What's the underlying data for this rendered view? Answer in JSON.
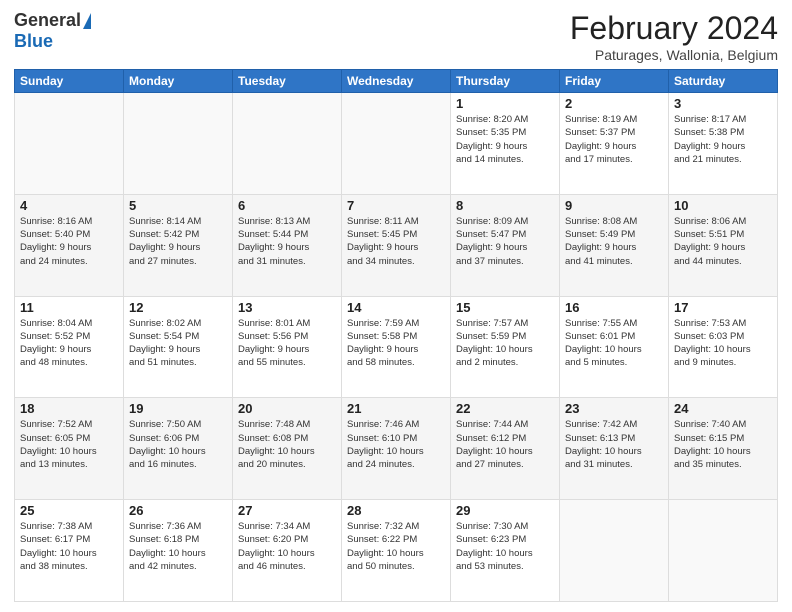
{
  "header": {
    "logo_general": "General",
    "logo_blue": "Blue",
    "title": "February 2024",
    "location": "Paturages, Wallonia, Belgium"
  },
  "days_of_week": [
    "Sunday",
    "Monday",
    "Tuesday",
    "Wednesday",
    "Thursday",
    "Friday",
    "Saturday"
  ],
  "weeks": [
    [
      {
        "day": "",
        "info": ""
      },
      {
        "day": "",
        "info": ""
      },
      {
        "day": "",
        "info": ""
      },
      {
        "day": "",
        "info": ""
      },
      {
        "day": "1",
        "info": "Sunrise: 8:20 AM\nSunset: 5:35 PM\nDaylight: 9 hours\nand 14 minutes."
      },
      {
        "day": "2",
        "info": "Sunrise: 8:19 AM\nSunset: 5:37 PM\nDaylight: 9 hours\nand 17 minutes."
      },
      {
        "day": "3",
        "info": "Sunrise: 8:17 AM\nSunset: 5:38 PM\nDaylight: 9 hours\nand 21 minutes."
      }
    ],
    [
      {
        "day": "4",
        "info": "Sunrise: 8:16 AM\nSunset: 5:40 PM\nDaylight: 9 hours\nand 24 minutes."
      },
      {
        "day": "5",
        "info": "Sunrise: 8:14 AM\nSunset: 5:42 PM\nDaylight: 9 hours\nand 27 minutes."
      },
      {
        "day": "6",
        "info": "Sunrise: 8:13 AM\nSunset: 5:44 PM\nDaylight: 9 hours\nand 31 minutes."
      },
      {
        "day": "7",
        "info": "Sunrise: 8:11 AM\nSunset: 5:45 PM\nDaylight: 9 hours\nand 34 minutes."
      },
      {
        "day": "8",
        "info": "Sunrise: 8:09 AM\nSunset: 5:47 PM\nDaylight: 9 hours\nand 37 minutes."
      },
      {
        "day": "9",
        "info": "Sunrise: 8:08 AM\nSunset: 5:49 PM\nDaylight: 9 hours\nand 41 minutes."
      },
      {
        "day": "10",
        "info": "Sunrise: 8:06 AM\nSunset: 5:51 PM\nDaylight: 9 hours\nand 44 minutes."
      }
    ],
    [
      {
        "day": "11",
        "info": "Sunrise: 8:04 AM\nSunset: 5:52 PM\nDaylight: 9 hours\nand 48 minutes."
      },
      {
        "day": "12",
        "info": "Sunrise: 8:02 AM\nSunset: 5:54 PM\nDaylight: 9 hours\nand 51 minutes."
      },
      {
        "day": "13",
        "info": "Sunrise: 8:01 AM\nSunset: 5:56 PM\nDaylight: 9 hours\nand 55 minutes."
      },
      {
        "day": "14",
        "info": "Sunrise: 7:59 AM\nSunset: 5:58 PM\nDaylight: 9 hours\nand 58 minutes."
      },
      {
        "day": "15",
        "info": "Sunrise: 7:57 AM\nSunset: 5:59 PM\nDaylight: 10 hours\nand 2 minutes."
      },
      {
        "day": "16",
        "info": "Sunrise: 7:55 AM\nSunset: 6:01 PM\nDaylight: 10 hours\nand 5 minutes."
      },
      {
        "day": "17",
        "info": "Sunrise: 7:53 AM\nSunset: 6:03 PM\nDaylight: 10 hours\nand 9 minutes."
      }
    ],
    [
      {
        "day": "18",
        "info": "Sunrise: 7:52 AM\nSunset: 6:05 PM\nDaylight: 10 hours\nand 13 minutes."
      },
      {
        "day": "19",
        "info": "Sunrise: 7:50 AM\nSunset: 6:06 PM\nDaylight: 10 hours\nand 16 minutes."
      },
      {
        "day": "20",
        "info": "Sunrise: 7:48 AM\nSunset: 6:08 PM\nDaylight: 10 hours\nand 20 minutes."
      },
      {
        "day": "21",
        "info": "Sunrise: 7:46 AM\nSunset: 6:10 PM\nDaylight: 10 hours\nand 24 minutes."
      },
      {
        "day": "22",
        "info": "Sunrise: 7:44 AM\nSunset: 6:12 PM\nDaylight: 10 hours\nand 27 minutes."
      },
      {
        "day": "23",
        "info": "Sunrise: 7:42 AM\nSunset: 6:13 PM\nDaylight: 10 hours\nand 31 minutes."
      },
      {
        "day": "24",
        "info": "Sunrise: 7:40 AM\nSunset: 6:15 PM\nDaylight: 10 hours\nand 35 minutes."
      }
    ],
    [
      {
        "day": "25",
        "info": "Sunrise: 7:38 AM\nSunset: 6:17 PM\nDaylight: 10 hours\nand 38 minutes."
      },
      {
        "day": "26",
        "info": "Sunrise: 7:36 AM\nSunset: 6:18 PM\nDaylight: 10 hours\nand 42 minutes."
      },
      {
        "day": "27",
        "info": "Sunrise: 7:34 AM\nSunset: 6:20 PM\nDaylight: 10 hours\nand 46 minutes."
      },
      {
        "day": "28",
        "info": "Sunrise: 7:32 AM\nSunset: 6:22 PM\nDaylight: 10 hours\nand 50 minutes."
      },
      {
        "day": "29",
        "info": "Sunrise: 7:30 AM\nSunset: 6:23 PM\nDaylight: 10 hours\nand 53 minutes."
      },
      {
        "day": "",
        "info": ""
      },
      {
        "day": "",
        "info": ""
      }
    ]
  ]
}
